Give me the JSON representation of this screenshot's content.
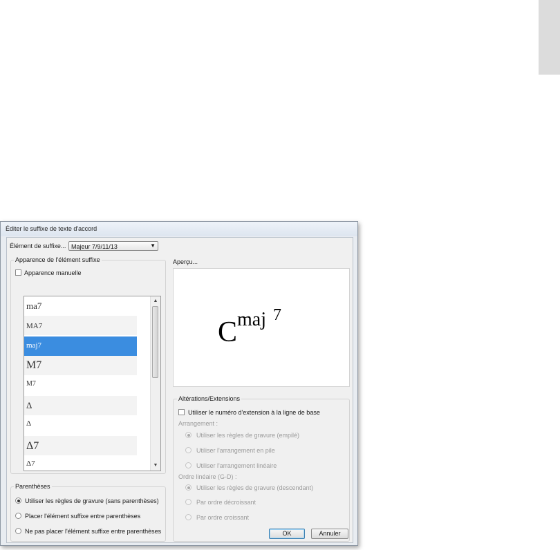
{
  "dialog": {
    "title": "Éditer le suffixe de texte d'accord",
    "element_label": "Élément de suffixe...",
    "element_value": "Majeur 7/9/11/13"
  },
  "appearance": {
    "group_title": "Apparence de l'élément suffixe",
    "manual_label": "Apparence manuelle",
    "manual_checked": false,
    "items": [
      {
        "label": "ma7",
        "selected": false
      },
      {
        "label": "MA7",
        "selected": false
      },
      {
        "label": "maj7",
        "selected": true
      },
      {
        "label": "M7",
        "selected": false
      },
      {
        "label": "M7",
        "selected": false
      },
      {
        "label": "Δ",
        "selected": false
      },
      {
        "label": "Δ",
        "selected": false
      },
      {
        "label": "Δ7",
        "selected": false
      },
      {
        "label": "Δ7",
        "selected": false
      }
    ]
  },
  "preview": {
    "title": "Aperçu...",
    "root": "C",
    "suffix": "maj",
    "extension": "7"
  },
  "parentheses": {
    "group_title": "Parenthèses",
    "options": [
      {
        "label": "Utiliser les règles de gravure (sans parenthèses)",
        "checked": true
      },
      {
        "label": "Placer l'élément suffixe entre parenthèses",
        "checked": false
      },
      {
        "label": "Ne pas placer l'élément suffixe entre parenthèses",
        "checked": false
      }
    ]
  },
  "alterations": {
    "group_title": "Altérations/Extensions",
    "baseline_label": "Utiliser le numéro d'extension à la ligne de base",
    "baseline_checked": false,
    "arrangement_label": "Arrangement :",
    "arrangement_options": [
      {
        "label": "Utiliser les règles de gravure (empilé)",
        "checked": true
      },
      {
        "label": "Utiliser l'arrangement en pile",
        "checked": false
      },
      {
        "label": "Utiliser l'arrangement linéaire",
        "checked": false
      }
    ],
    "order_label": "Ordre linéaire (G-D) :",
    "order_options": [
      {
        "label": "Utiliser les règles de gravure (descendant)",
        "checked": true
      },
      {
        "label": "Par ordre décroissant",
        "checked": false
      },
      {
        "label": "Par ordre croissant",
        "checked": false
      }
    ]
  },
  "buttons": {
    "ok": "OK",
    "cancel": "Annuler"
  },
  "colors": {
    "selection": "#3b8de0",
    "dialog_bg": "#f0f0f0",
    "side_tab": "#dcdcdc"
  }
}
